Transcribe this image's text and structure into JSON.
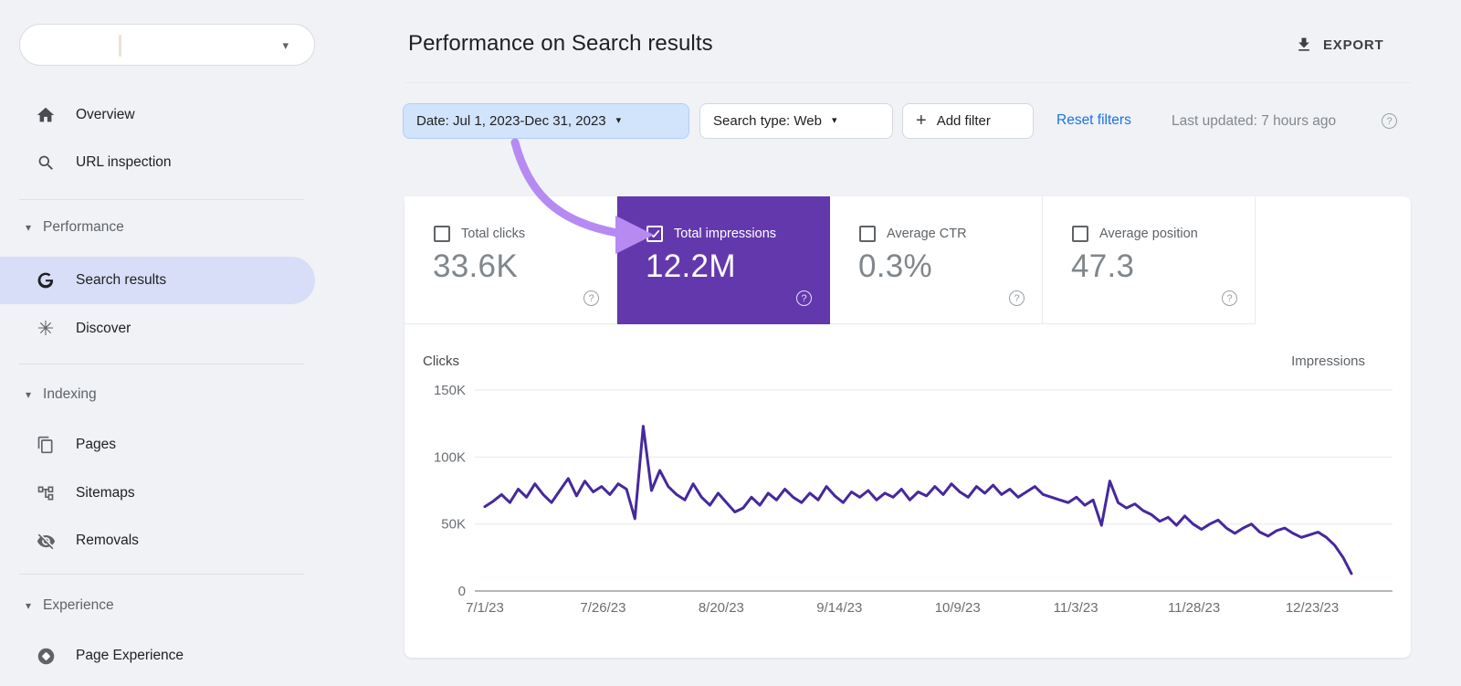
{
  "icons": {
    "caret_down": "▾",
    "plus": "+",
    "help": "?",
    "discover": "✳"
  },
  "sidebar": {
    "property_selector": {
      "value": ""
    },
    "items_top": [
      {
        "label": "Overview"
      },
      {
        "label": "URL inspection"
      }
    ],
    "sections": [
      {
        "label": "Performance",
        "items": [
          {
            "label": "Search results",
            "selected": true
          },
          {
            "label": "Discover",
            "selected": false
          }
        ]
      },
      {
        "label": "Indexing",
        "items": [
          {
            "label": "Pages"
          },
          {
            "label": "Sitemaps"
          },
          {
            "label": "Removals"
          }
        ]
      },
      {
        "label": "Experience",
        "items": [
          {
            "label": "Page Experience"
          }
        ]
      }
    ]
  },
  "header": {
    "title": "Performance on Search results",
    "export_label": "EXPORT"
  },
  "filters": {
    "date": "Date: Jul 1, 2023-Dec 31, 2023",
    "search_type": "Search type: Web",
    "add_filter": "Add filter",
    "reset": "Reset filters",
    "last_updated": "Last updated: 7 hours ago"
  },
  "metrics": [
    {
      "label": "Total clicks",
      "value": "33.6K",
      "checked": false,
      "selected": false
    },
    {
      "label": "Total impressions",
      "value": "12.2M",
      "checked": true,
      "selected": true,
      "color": "#6438ad"
    },
    {
      "label": "Average CTR",
      "value": "0.3%",
      "checked": false,
      "selected": false
    },
    {
      "label": "Average position",
      "value": "47.3",
      "checked": false,
      "selected": false
    }
  ],
  "chart_data": {
    "type": "line",
    "title": "Total impressions over time (Jul 1, 2023 - Dec 31, 2023)",
    "left_axis_label": "Clicks",
    "right_axis_label": "Impressions",
    "y_tick_labels": [
      "150K",
      "100K",
      "50K",
      "0"
    ],
    "y_tick_values": [
      150,
      100,
      50,
      0
    ],
    "ylim_thousands": [
      0,
      150
    ],
    "x_tick_labels": [
      "7/1/23",
      "7/26/23",
      "8/20/23",
      "9/14/23",
      "10/9/23",
      "11/3/23",
      "11/28/23",
      "12/23/23"
    ],
    "grid": true,
    "legend_position": "none",
    "series": [
      {
        "name": "Total impressions",
        "color": "#46289e",
        "unit": "thousands_per_day",
        "values": [
          63,
          67,
          72,
          66,
          76,
          70,
          80,
          72,
          66,
          75,
          84,
          71,
          82,
          74,
          78,
          72,
          80,
          76,
          54,
          123,
          75,
          90,
          78,
          72,
          68,
          80,
          70,
          64,
          73,
          66,
          59,
          62,
          70,
          64,
          73,
          68,
          76,
          70,
          66,
          73,
          68,
          78,
          71,
          66,
          74,
          70,
          75,
          68,
          73,
          70,
          76,
          68,
          74,
          71,
          78,
          72,
          80,
          74,
          70,
          78,
          73,
          79,
          72,
          76,
          70,
          74,
          78,
          72,
          70,
          68,
          66,
          70,
          64,
          68,
          49,
          82,
          66,
          62,
          65,
          60,
          57,
          52,
          55,
          49,
          56,
          50,
          46,
          50,
          53,
          47,
          43,
          47,
          50,
          44,
          41,
          45,
          47,
          43,
          40,
          42,
          44,
          40,
          34,
          25,
          13
        ]
      }
    ]
  }
}
